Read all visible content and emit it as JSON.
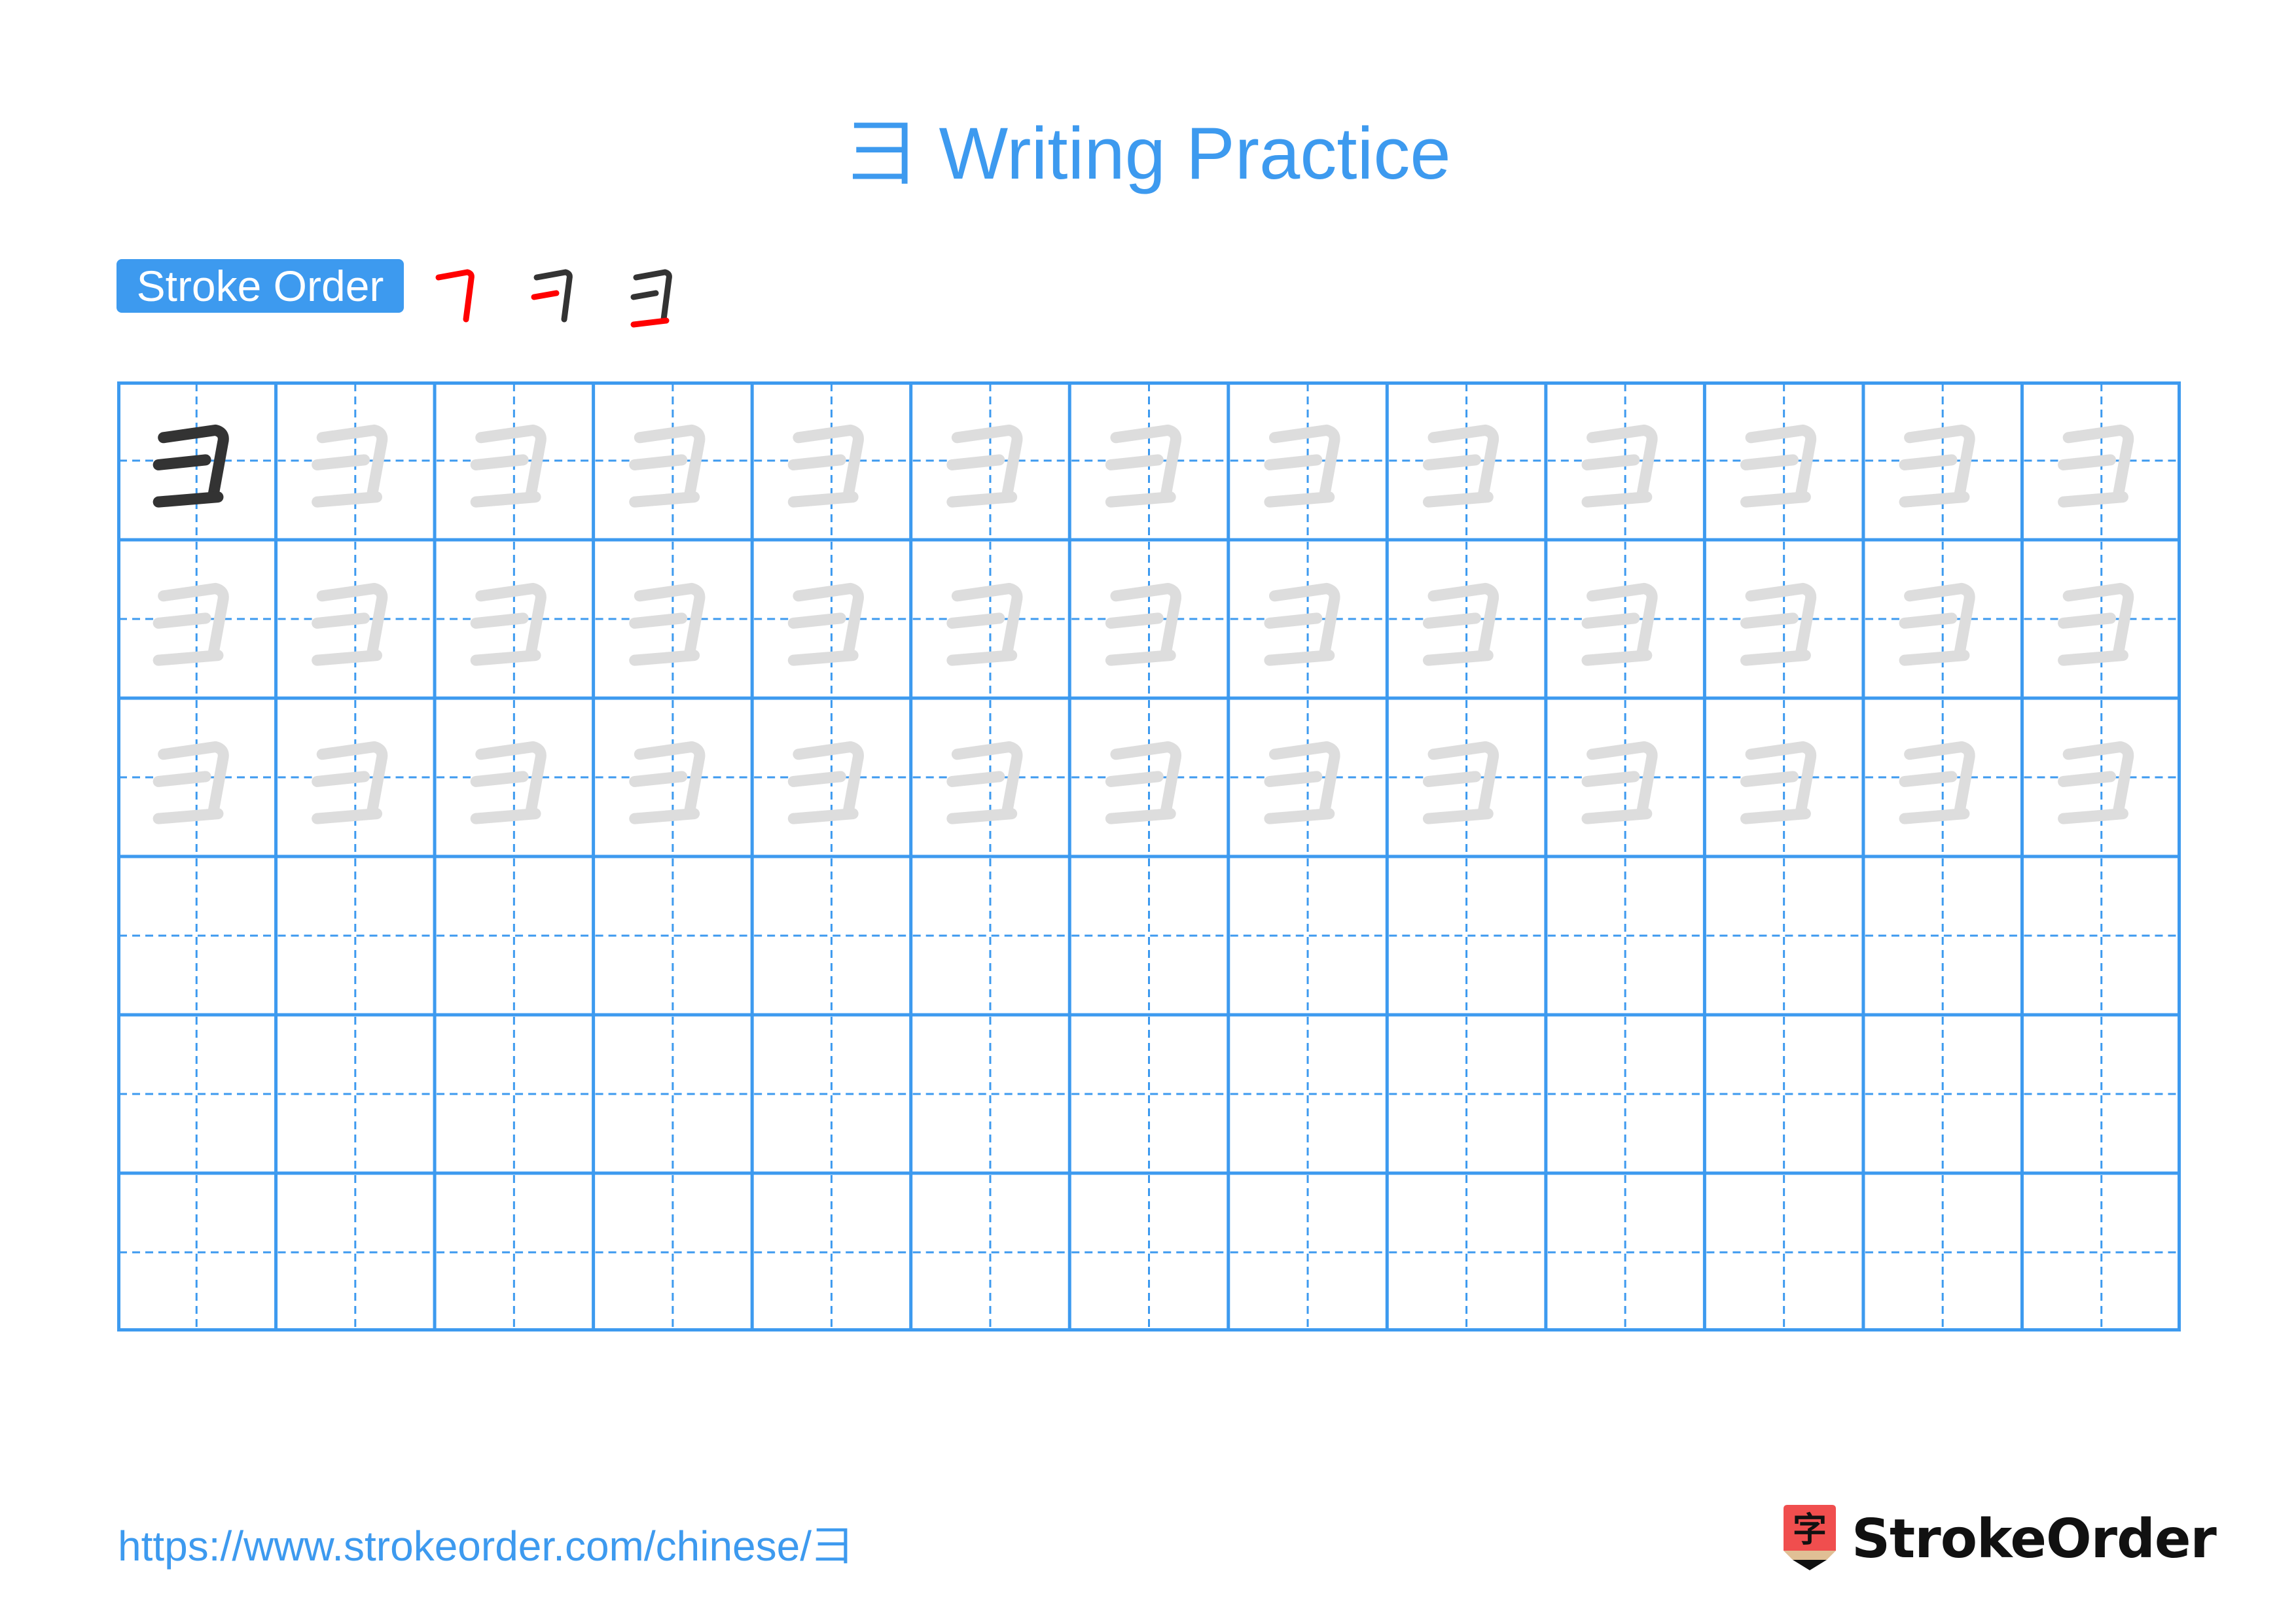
{
  "title": "彐 Writing Practice",
  "character": "彐",
  "stroke_order": {
    "label": "Stroke Order",
    "steps": [
      {
        "step": 1,
        "strokes_total": 1
      },
      {
        "step": 2,
        "strokes_total": 2
      },
      {
        "step": 3,
        "strokes_total": 3
      }
    ],
    "highlight_color": "#ff0000",
    "done_color": "#333333"
  },
  "practice_grid": {
    "rows": 6,
    "columns": 13,
    "model_cells": 1,
    "trace_rows": 3,
    "empty_rows": 3,
    "line_color": "#3d9aef",
    "model_color": "#333333",
    "trace_color": "#dddddd"
  },
  "footer": {
    "url": "https://www.strokeorder.com/chinese/彐",
    "brand": "StrokeOrder",
    "brand_icon_glyph": "字"
  }
}
